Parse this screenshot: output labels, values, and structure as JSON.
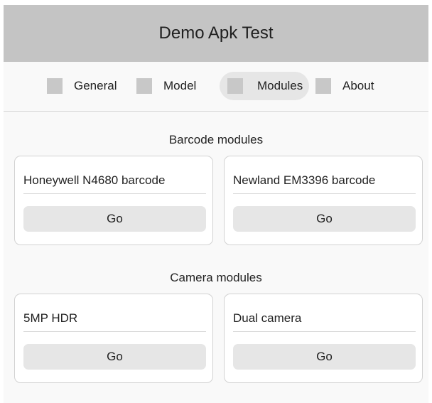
{
  "app": {
    "title": "Demo Apk Test"
  },
  "tabs": [
    {
      "label": "General",
      "active": false
    },
    {
      "label": "Model",
      "active": false
    },
    {
      "label": "Modules",
      "active": true
    },
    {
      "label": "About",
      "active": false
    }
  ],
  "sections": [
    {
      "title": "Barcode modules",
      "cards": [
        {
          "name": "Honeywell N4680 barcode",
          "button": "Go"
        },
        {
          "name": "Newland EM3396 barcode",
          "button": "Go"
        }
      ]
    },
    {
      "title": "Camera modules",
      "cards": [
        {
          "name": "5MP HDR",
          "button": "Go"
        },
        {
          "name": "Dual camera",
          "button": "Go"
        }
      ]
    }
  ],
  "colors": {
    "titlebar": "#c4c4c4",
    "tab_square": "#c8c8c8",
    "active_tab": "#e6e6e6",
    "button": "#e6e6e6",
    "background": "#f9f9f9"
  }
}
